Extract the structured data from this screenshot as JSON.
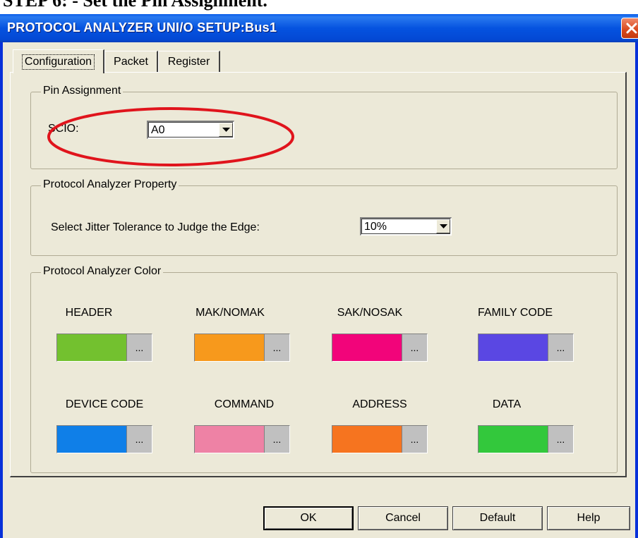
{
  "doc_heading": "STEP 6: - Set the Pin Assignment.",
  "window": {
    "title": "PROTOCOL ANALYZER UNI/O SETUP:Bus1"
  },
  "tabs": [
    {
      "label": "Configuration",
      "active": true
    },
    {
      "label": "Packet",
      "active": false
    },
    {
      "label": "Register",
      "active": false
    }
  ],
  "pin_assignment": {
    "group_label": "Pin Assignment",
    "scio_label": "SCIO:",
    "scio_value": "A0"
  },
  "property": {
    "group_label": "Protocol Analyzer Property",
    "jitter_label": "Select Jitter Tolerance to Judge the Edge:",
    "jitter_value": "10%"
  },
  "colors": {
    "group_label": "Protocol Analyzer Color",
    "ellipsis": "...",
    "items": [
      {
        "label": "HEADER",
        "color": "#73c12f"
      },
      {
        "label": "MAK/NOMAK",
        "color": "#f7991c"
      },
      {
        "label": "SAK/NOSAK",
        "color": "#f2047a"
      },
      {
        "label": "FAMILY CODE",
        "color": "#5a47e3"
      },
      {
        "label": "DEVICE CODE",
        "color": "#0f7fe8"
      },
      {
        "label": "COMMAND",
        "color": "#ee82a5"
      },
      {
        "label": "ADDRESS",
        "color": "#f6741f"
      },
      {
        "label": "DATA",
        "color": "#33c83c"
      }
    ]
  },
  "buttons": {
    "ok": "OK",
    "cancel": "Cancel",
    "default": "Default",
    "help": "Help"
  },
  "annotation_color": "#e0141c"
}
